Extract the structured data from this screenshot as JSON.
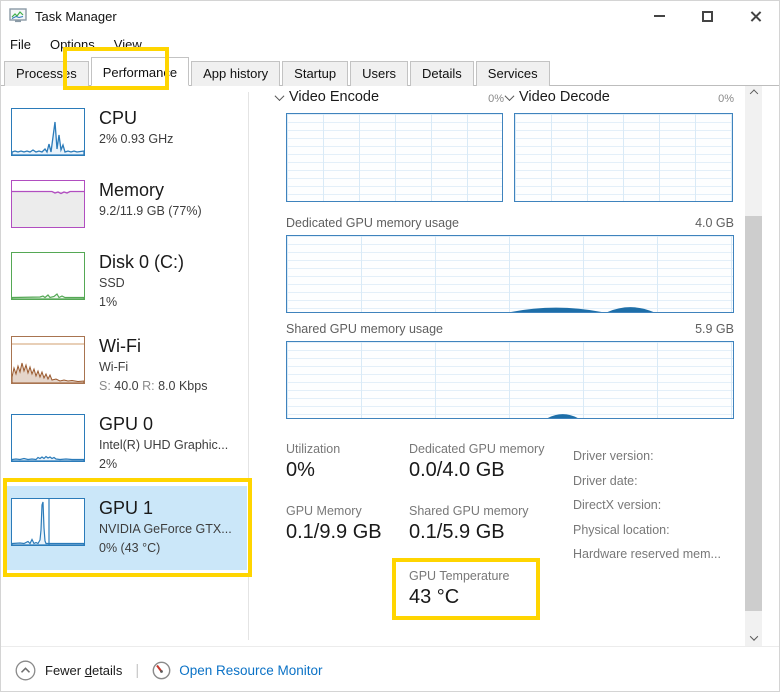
{
  "window": {
    "title": "Task Manager"
  },
  "icons": {
    "app": "monitor-chart",
    "minimize": "minimize-bar",
    "maximize": "maximize-square",
    "close": "close-x",
    "section_chevron": "chevron-down",
    "scroll_up": "chevron-up",
    "scroll_down": "chevron-down",
    "fewer_details": "circle-chevron-up",
    "resource_monitor": "gauge"
  },
  "colors": {
    "highlight_yellow": "#ffd500",
    "selection_bg": "#cbe7f9",
    "link_blue": "#0b72c6",
    "chart_blue": "#2b7bb9",
    "chart_purple": "#b14ec0",
    "chart_green": "#55a855",
    "chart_brown": "#a87450"
  },
  "menu": {
    "items": [
      "File",
      "Options",
      "View"
    ]
  },
  "tabs": {
    "active": "Performance",
    "items": [
      "Processes",
      "Performance",
      "App history",
      "Startup",
      "Users",
      "Details",
      "Services"
    ]
  },
  "sidebar": {
    "items": [
      {
        "title": "CPU",
        "line1": "2% 0.93 GHz"
      },
      {
        "title": "Memory",
        "line1": "9.2/11.9 GB (77%)"
      },
      {
        "title": "Disk 0 (C:)",
        "line1": "SSD",
        "line2": "1%"
      },
      {
        "title": "Wi-Fi",
        "line1": "Wi-Fi",
        "s_label": "S:",
        "s_value": "40.0",
        "r_label": "R:",
        "r_value": "8.0 Kbps"
      },
      {
        "title": "GPU 0",
        "line1": "Intel(R) UHD Graphic...",
        "line2": "2%"
      },
      {
        "title": "GPU 1",
        "line1": "NVIDIA GeForce GTX...",
        "line2": "0% (43 °C)",
        "selected": true
      }
    ]
  },
  "main": {
    "video_encode": {
      "title": "Video Encode",
      "value": "0%"
    },
    "video_decode": {
      "title": "Video Decode",
      "value": "0%"
    },
    "dedicated_chart": {
      "title": "Dedicated GPU memory usage",
      "max": "4.0 GB"
    },
    "shared_chart": {
      "title": "Shared GPU memory usage",
      "max": "5.9 GB"
    },
    "stats": {
      "utilization": {
        "label": "Utilization",
        "value": "0%"
      },
      "dedicated_memory": {
        "label": "Dedicated GPU memory",
        "value": "0.0/4.0 GB"
      },
      "gpu_memory": {
        "label": "GPU Memory",
        "value": "0.1/9.9 GB"
      },
      "shared_memory": {
        "label": "Shared GPU memory",
        "value": "0.1/5.9 GB"
      },
      "temperature": {
        "label": "GPU Temperature",
        "value": "43 °C"
      }
    },
    "info": {
      "labels": [
        "Driver version:",
        "Driver date:",
        "DirectX version:",
        "Physical location:",
        "Hardware reserved mem..."
      ]
    }
  },
  "footer": {
    "fewer_details": {
      "prefix": "Fewer ",
      "accesskey": "d",
      "suffix": "etails"
    },
    "separator": "|",
    "open_resource_monitor": "Open Resource Monitor"
  }
}
